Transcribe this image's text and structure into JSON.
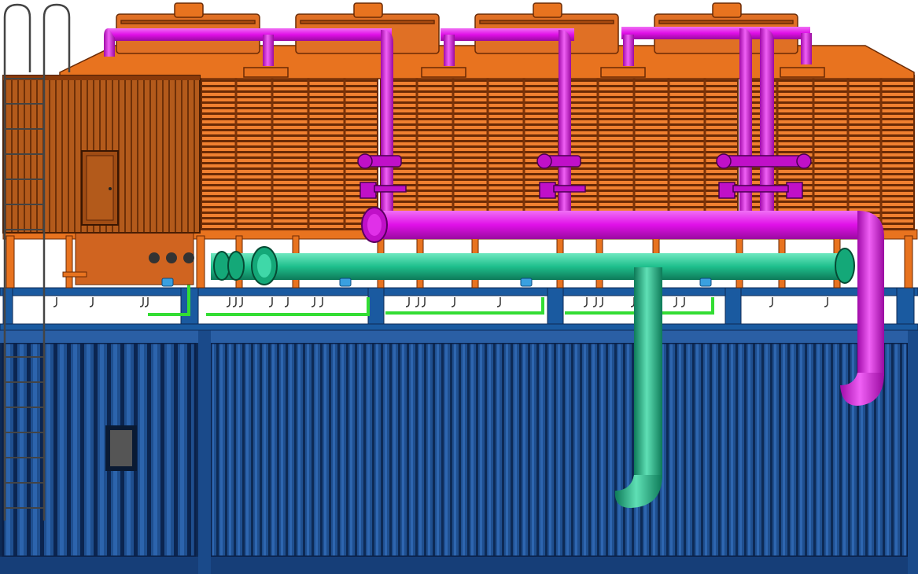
{
  "scene": {
    "subject": "cooling-tower-assembly-render",
    "background_color": "#ffffff",
    "tower_count": 4,
    "colors": {
      "tower_orange": "#e8731f",
      "tower_dark": "#8a3a0a",
      "housing_brown": "#b35a1b",
      "container_blue": "#1f4f8f",
      "container_dark": "#0d2a55",
      "frame_blue": "#1a5aa0",
      "supply_pipe_magenta": "#e010e8",
      "return_pipe_teal": "#1fbf8c",
      "small_pipe_green": "#33dd33",
      "window_gray": "#555555"
    },
    "icons": [
      "ladder-icon",
      "door-icon",
      "valve-icon",
      "flange-icon"
    ]
  }
}
